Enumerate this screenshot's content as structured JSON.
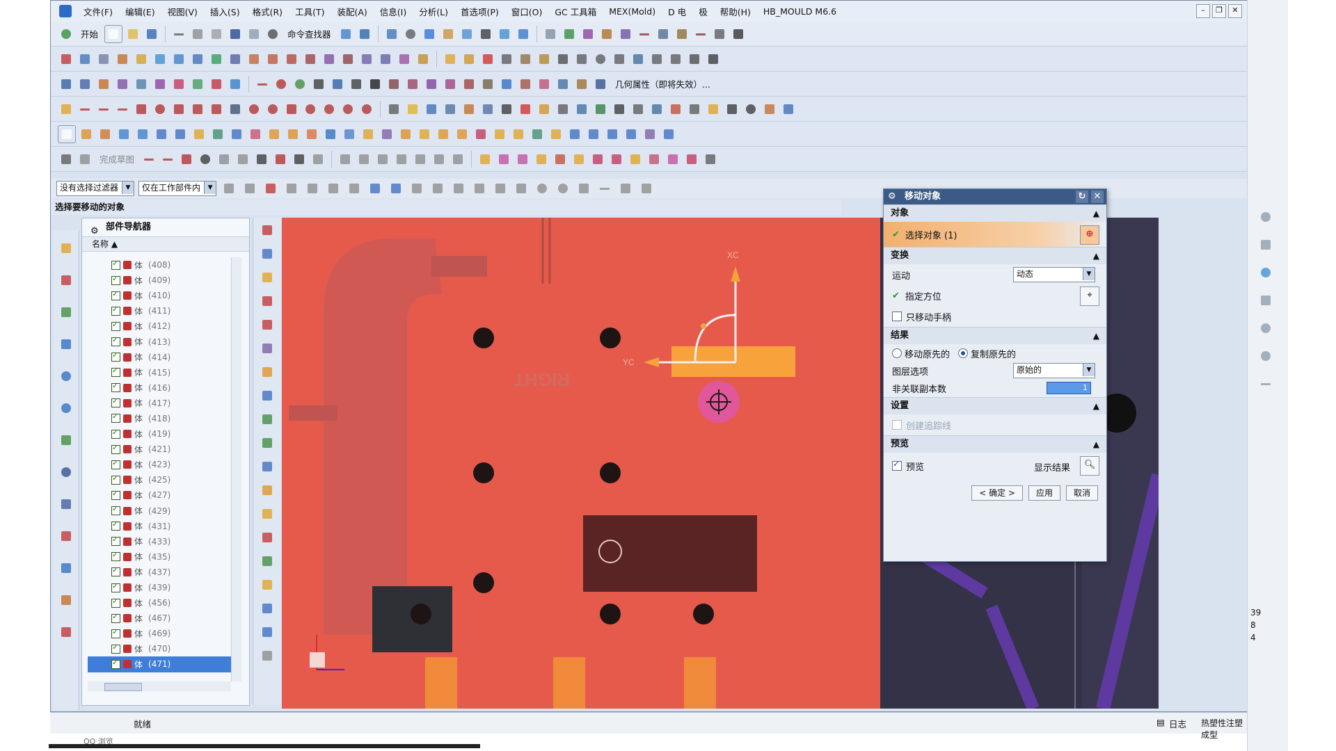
{
  "menu": {
    "items": [
      "文件(F)",
      "编辑(E)",
      "视图(V)",
      "插入(S)",
      "格式(R)",
      "工具(T)",
      "装配(A)",
      "信息(I)",
      "分析(L)",
      "首选项(P)",
      "窗口(O)",
      "GC 工具箱",
      "MEX(Mold)",
      "D 电",
      "极",
      "帮助(H)",
      "HB_MOULD M6.6"
    ]
  },
  "toolbar": {
    "start_label": "开始",
    "command_finder_label": "命令查找器",
    "geometry_property_label": "几何属性（即将失效）...",
    "sketch_label": "完成草图"
  },
  "filterbar": {
    "selection_filter": "没有选择过滤器",
    "scope": "仅在工作部件内"
  },
  "cue_line": "选择要移动的对象",
  "navigator": {
    "title": "部件导航器",
    "column_name": "名称",
    "rows": [
      {
        "name": "体",
        "num": "(408)",
        "selected": false
      },
      {
        "name": "体",
        "num": "(409)",
        "selected": false
      },
      {
        "name": "体",
        "num": "(410)",
        "selected": false
      },
      {
        "name": "体",
        "num": "(411)",
        "selected": false
      },
      {
        "name": "体",
        "num": "(412)",
        "selected": false
      },
      {
        "name": "体",
        "num": "(413)",
        "selected": false
      },
      {
        "name": "体",
        "num": "(414)",
        "selected": false
      },
      {
        "name": "体",
        "num": "(415)",
        "selected": false
      },
      {
        "name": "体",
        "num": "(416)",
        "selected": false
      },
      {
        "name": "体",
        "num": "(417)",
        "selected": false
      },
      {
        "name": "体",
        "num": "(418)",
        "selected": false
      },
      {
        "name": "体",
        "num": "(419)",
        "selected": false
      },
      {
        "name": "体",
        "num": "(421)",
        "selected": false
      },
      {
        "name": "体",
        "num": "(423)",
        "selected": false
      },
      {
        "name": "体",
        "num": "(425)",
        "selected": false
      },
      {
        "name": "体",
        "num": "(427)",
        "selected": false
      },
      {
        "name": "体",
        "num": "(429)",
        "selected": false
      },
      {
        "name": "体",
        "num": "(431)",
        "selected": false
      },
      {
        "name": "体",
        "num": "(433)",
        "selected": false
      },
      {
        "name": "体",
        "num": "(435)",
        "selected": false
      },
      {
        "name": "体",
        "num": "(437)",
        "selected": false
      },
      {
        "name": "体",
        "num": "(439)",
        "selected": false
      },
      {
        "name": "体",
        "num": "(456)",
        "selected": false
      },
      {
        "name": "体",
        "num": "(467)",
        "selected": false
      },
      {
        "name": "体",
        "num": "(469)",
        "selected": false
      },
      {
        "name": "体",
        "num": "(470)",
        "selected": false
      },
      {
        "name": "体",
        "num": "(471)",
        "selected": true
      }
    ]
  },
  "viewport": {
    "axis_xc": "XC",
    "axis_yc": "YC",
    "emboss_text": "RIGHT"
  },
  "dialog": {
    "title": "移动对象",
    "section_object": "对象",
    "select_object": "选择对象 (1)",
    "section_transform": "变换",
    "motion_label": "运动",
    "motion_value": "动态",
    "specify_orientation": "指定方位",
    "move_handle_only": "只移动手柄",
    "section_result": "结果",
    "move_original": "移动原先的",
    "copy_original": "复制原先的",
    "layer_option_label": "图层选项",
    "layer_option_value": "原始的",
    "non_assoc_copies_label": "非关联副本数",
    "non_assoc_copies_value": "1",
    "section_settings": "设置",
    "create_trace": "创建追踪线",
    "section_preview": "预览",
    "preview": "预览",
    "show_result": "显示结果",
    "ok": "< 确定 >",
    "apply": "应用",
    "cancel": "取消"
  },
  "status": {
    "text": "就绪",
    "log": "日志",
    "right_label": "热塑性注塑成型",
    "qq_label": "QQ 浏览"
  },
  "right_strip_numbers": [
    "39",
    "8",
    "4"
  ],
  "colors": {
    "highlight_red": "#e65a4c",
    "preview_orange": "#f7a23a",
    "selected_blue": "#3e7ed8",
    "dark_panel": "#3a3850"
  }
}
